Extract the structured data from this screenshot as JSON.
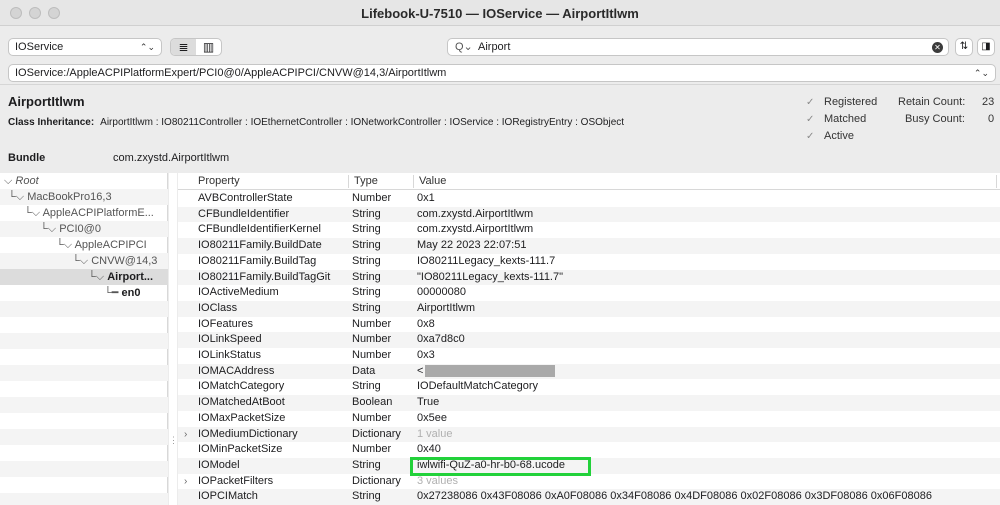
{
  "window": {
    "title": "Lifebook-U-7510 — IOService — AirportItlwm"
  },
  "toolbar": {
    "plane_select": "IOService",
    "search_query": "Airport",
    "path": "IOService:/AppleACPIPlatformExpert/PCI0@0/AppleACPIPCI/CNVW@14,3/AirportItlwm"
  },
  "info": {
    "class_name": "AirportItlwm",
    "inheritance_label": "Class Inheritance:",
    "inheritance": "AirportItlwm : IO80211Controller : IOEthernetController : IONetworkController : IOService : IORegistryEntry : OSObject",
    "status": [
      "Registered",
      "Matched",
      "Active"
    ],
    "retain_label": "Retain Count:",
    "retain_value": "23",
    "busy_label": "Busy Count:",
    "busy_value": "0",
    "bundle_label": "Bundle",
    "bundle_value": "com.zxystd.AirportItlwm"
  },
  "tree": [
    {
      "label": "Root",
      "prefix": "⌵",
      "italic": true
    },
    {
      "label": "MacBookPro16,3",
      "prefix": "└⌵"
    },
    {
      "label": "AppleACPIPlatformE...",
      "prefix": "└⌵"
    },
    {
      "label": "PCI0@0",
      "prefix": "└⌵"
    },
    {
      "label": "AppleACPIPCI",
      "prefix": "└⌵"
    },
    {
      "label": "CNVW@14,3",
      "prefix": "└⌵"
    },
    {
      "label": "Airport...",
      "prefix": "└⌵",
      "bold": true
    },
    {
      "label": "en0",
      "prefix": "└━",
      "bold": true
    }
  ],
  "table": {
    "headers": [
      "Property",
      "Type",
      "Value"
    ],
    "rows": [
      {
        "p": "AVBControllerState",
        "t": "Number",
        "v": "0x1"
      },
      {
        "p": "CFBundleIdentifier",
        "t": "String",
        "v": "com.zxystd.AirportItlwm"
      },
      {
        "p": "CFBundleIdentifierKernel",
        "t": "String",
        "v": "com.zxystd.AirportItlwm"
      },
      {
        "p": "IO80211Family.BuildDate",
        "t": "String",
        "v": "May 22 2023 22:07:51"
      },
      {
        "p": "IO80211Family.BuildTag",
        "t": "String",
        "v": "IO80211Legacy_kexts-111.7"
      },
      {
        "p": "IO80211Family.BuildTagGit",
        "t": "String",
        "v": "\"IO80211Legacy_kexts-111.7\""
      },
      {
        "p": "IOActiveMedium",
        "t": "String",
        "v": "00000080"
      },
      {
        "p": "IOClass",
        "t": "String",
        "v": "AirportItlwm"
      },
      {
        "p": "IOFeatures",
        "t": "Number",
        "v": "0x8"
      },
      {
        "p": "IOLinkSpeed",
        "t": "Number",
        "v": "0xa7d8c0"
      },
      {
        "p": "IOLinkStatus",
        "t": "Number",
        "v": "0x3"
      },
      {
        "p": "IOMACAddress",
        "t": "Data",
        "v": "<"
      },
      {
        "p": "IOMatchCategory",
        "t": "String",
        "v": "IODefaultMatchCategory"
      },
      {
        "p": "IOMatchedAtBoot",
        "t": "Boolean",
        "v": "True"
      },
      {
        "p": "IOMaxPacketSize",
        "t": "Number",
        "v": "0x5ee"
      },
      {
        "p": "IOMediumDictionary",
        "t": "Dictionary",
        "v": "1 value"
      },
      {
        "p": "IOMinPacketSize",
        "t": "Number",
        "v": "0x40"
      },
      {
        "p": "IOModel",
        "t": "String",
        "v": "iwlwifi-QuZ-a0-hr-b0-68.ucode"
      },
      {
        "p": "IOPacketFilters",
        "t": "Dictionary",
        "v": "3 values"
      },
      {
        "p": "IOPCIMatch",
        "t": "String",
        "v": "0x27238086 0x43F08086 0xA0F08086 0x34F08086 0x4DF08086 0x02F08086 0x3DF08086 0x06F08086"
      }
    ]
  }
}
